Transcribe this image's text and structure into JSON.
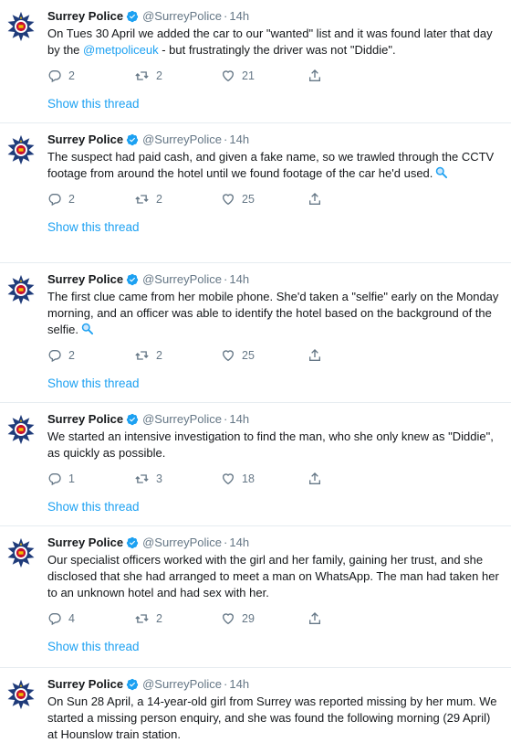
{
  "tweets": [
    {
      "name": "Surrey Police",
      "handle": "@SurreyPolice",
      "time": "14h",
      "text_before": "On Tues 30 April we added the car to our \"wanted\" list and it was found later that day by the ",
      "mention": "@metpoliceuk",
      "text_after": " - but frustratingly the driver was not \"Diddie\".",
      "replies": "2",
      "retweets": "2",
      "likes": "21",
      "thread_label": "Show this thread"
    },
    {
      "name": "Surrey Police",
      "handle": "@SurreyPolice",
      "time": "14h",
      "text": "The suspect had paid cash, and given a fake name, so we trawled through the CCTV footage from around the hotel until we found footage of the car he'd used.",
      "replies": "2",
      "retweets": "2",
      "likes": "25",
      "thread_label": "Show this thread"
    },
    {
      "name": "Surrey Police",
      "handle": "@SurreyPolice",
      "time": "14h",
      "text": "The first clue came from her mobile phone. She'd taken a \"selfie\" early on the Monday morning, and an officer was able to identify the hotel based on the background of the selfie.",
      "replies": "2",
      "retweets": "2",
      "likes": "25",
      "thread_label": "Show this thread"
    },
    {
      "name": "Surrey Police",
      "handle": "@SurreyPolice",
      "time": "14h",
      "text": "We started an intensive investigation to find the man, who she only knew as \"Diddie\", as quickly as possible.",
      "replies": "1",
      "retweets": "3",
      "likes": "18",
      "thread_label": "Show this thread"
    },
    {
      "name": "Surrey Police",
      "handle": "@SurreyPolice",
      "time": "14h",
      "text": "Our specialist officers worked with the girl and her family, gaining her trust, and she disclosed that she had arranged to meet a man on WhatsApp. The man had taken her to an unknown hotel and had sex with her.",
      "replies": "4",
      "retweets": "2",
      "likes": "29",
      "thread_label": "Show this thread"
    },
    {
      "name": "Surrey Police",
      "handle": "@SurreyPolice",
      "time": "14h",
      "text": "On Sun 28 April, a 14-year-old girl from Surrey was reported missing by her mum. We started a missing person enquiry, and she was found the following morning (29 April) at Hounslow train station."
    }
  ],
  "colors": {
    "link": "#1da1f2",
    "muted": "#657786",
    "verified": "#1da1f2",
    "badge_navy": "#1f3b7a"
  },
  "icons": [
    "police-badge-icon",
    "verified-icon",
    "reply-icon",
    "retweet-icon",
    "like-icon",
    "share-icon",
    "magnifier-icon"
  ]
}
